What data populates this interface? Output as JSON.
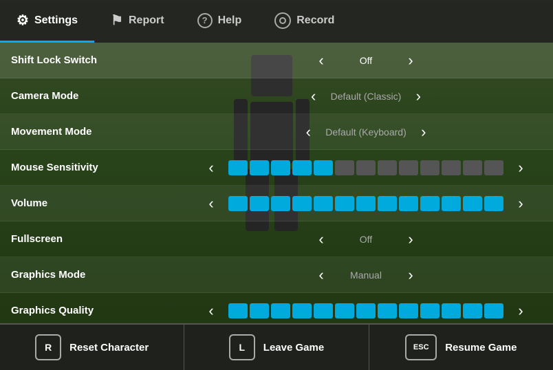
{
  "nav": {
    "tabs": [
      {
        "id": "settings",
        "label": "Settings",
        "icon": "⚙",
        "active": true
      },
      {
        "id": "report",
        "label": "Report",
        "icon": "⚑",
        "active": false
      },
      {
        "id": "help",
        "label": "Help",
        "icon": "?",
        "active": false
      },
      {
        "id": "record",
        "label": "Record",
        "icon": "◎",
        "active": false
      }
    ]
  },
  "settings": {
    "rows": [
      {
        "id": "shift-lock-switch",
        "label": "Shift Lock Switch",
        "type": "toggle",
        "value": "Off",
        "active": true
      },
      {
        "id": "camera-mode",
        "label": "Camera Mode",
        "type": "toggle",
        "value": "Default (Classic)",
        "active": false
      },
      {
        "id": "movement-mode",
        "label": "Movement Mode",
        "type": "toggle",
        "value": "Default (Keyboard)",
        "active": false
      },
      {
        "id": "mouse-sensitivity",
        "label": "Mouse Sensitivity",
        "type": "slider",
        "filled": 5,
        "total": 13,
        "active": false
      },
      {
        "id": "volume",
        "label": "Volume",
        "type": "slider",
        "filled": 13,
        "total": 13,
        "active": false
      },
      {
        "id": "fullscreen",
        "label": "Fullscreen",
        "type": "toggle",
        "value": "Off",
        "active": false
      },
      {
        "id": "graphics-mode",
        "label": "Graphics Mode",
        "type": "toggle",
        "value": "Manual",
        "active": false
      },
      {
        "id": "graphics-quality",
        "label": "Graphics Quality",
        "type": "slider",
        "filled": 13,
        "total": 13,
        "active": false
      }
    ]
  },
  "bottom_bar": {
    "buttons": [
      {
        "id": "reset-character",
        "key": "R",
        "label": "Reset Character"
      },
      {
        "id": "leave-game",
        "key": "L",
        "label": "Leave Game"
      },
      {
        "id": "resume-game",
        "key": "ESC",
        "label": "Resume Game"
      }
    ]
  },
  "colors": {
    "slider_filled": "#00aadd",
    "slider_empty": "#555555",
    "nav_active_border": "#00aaff",
    "panel_bg": "rgba(0,0,0,0.45)"
  }
}
